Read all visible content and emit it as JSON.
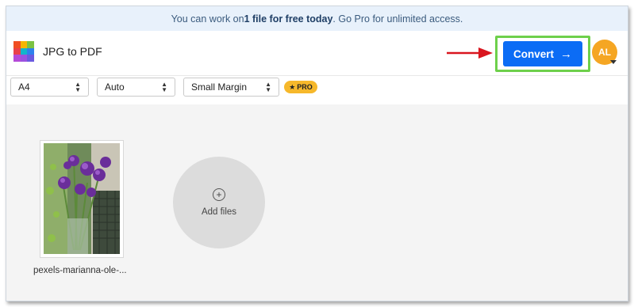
{
  "banner": {
    "text_before": "You can work on ",
    "text_bold": "1 file for free today",
    "text_after": ". Go Pro for unlimited access."
  },
  "header": {
    "app_title": "JPG to PDF",
    "convert_label": "Convert",
    "convert_arrow": "→",
    "avatar_initials": "AL",
    "logo_icon": "app-logo-grid-icon",
    "colors": {
      "convert": "#0b6cf5",
      "avatar": "#f5a623",
      "highlight": "#6ed04b",
      "annotation_arrow": "#d9161f"
    }
  },
  "toolbar": {
    "page_size": "A4",
    "orientation": "Auto",
    "margin": "Small Margin",
    "pro_label": "PRO",
    "pro_icon": "star-icon"
  },
  "files": [
    {
      "name": "pexels-marianna-ole-..."
    }
  ],
  "add_files": {
    "label": "Add files",
    "icon": "plus-circle-icon"
  }
}
